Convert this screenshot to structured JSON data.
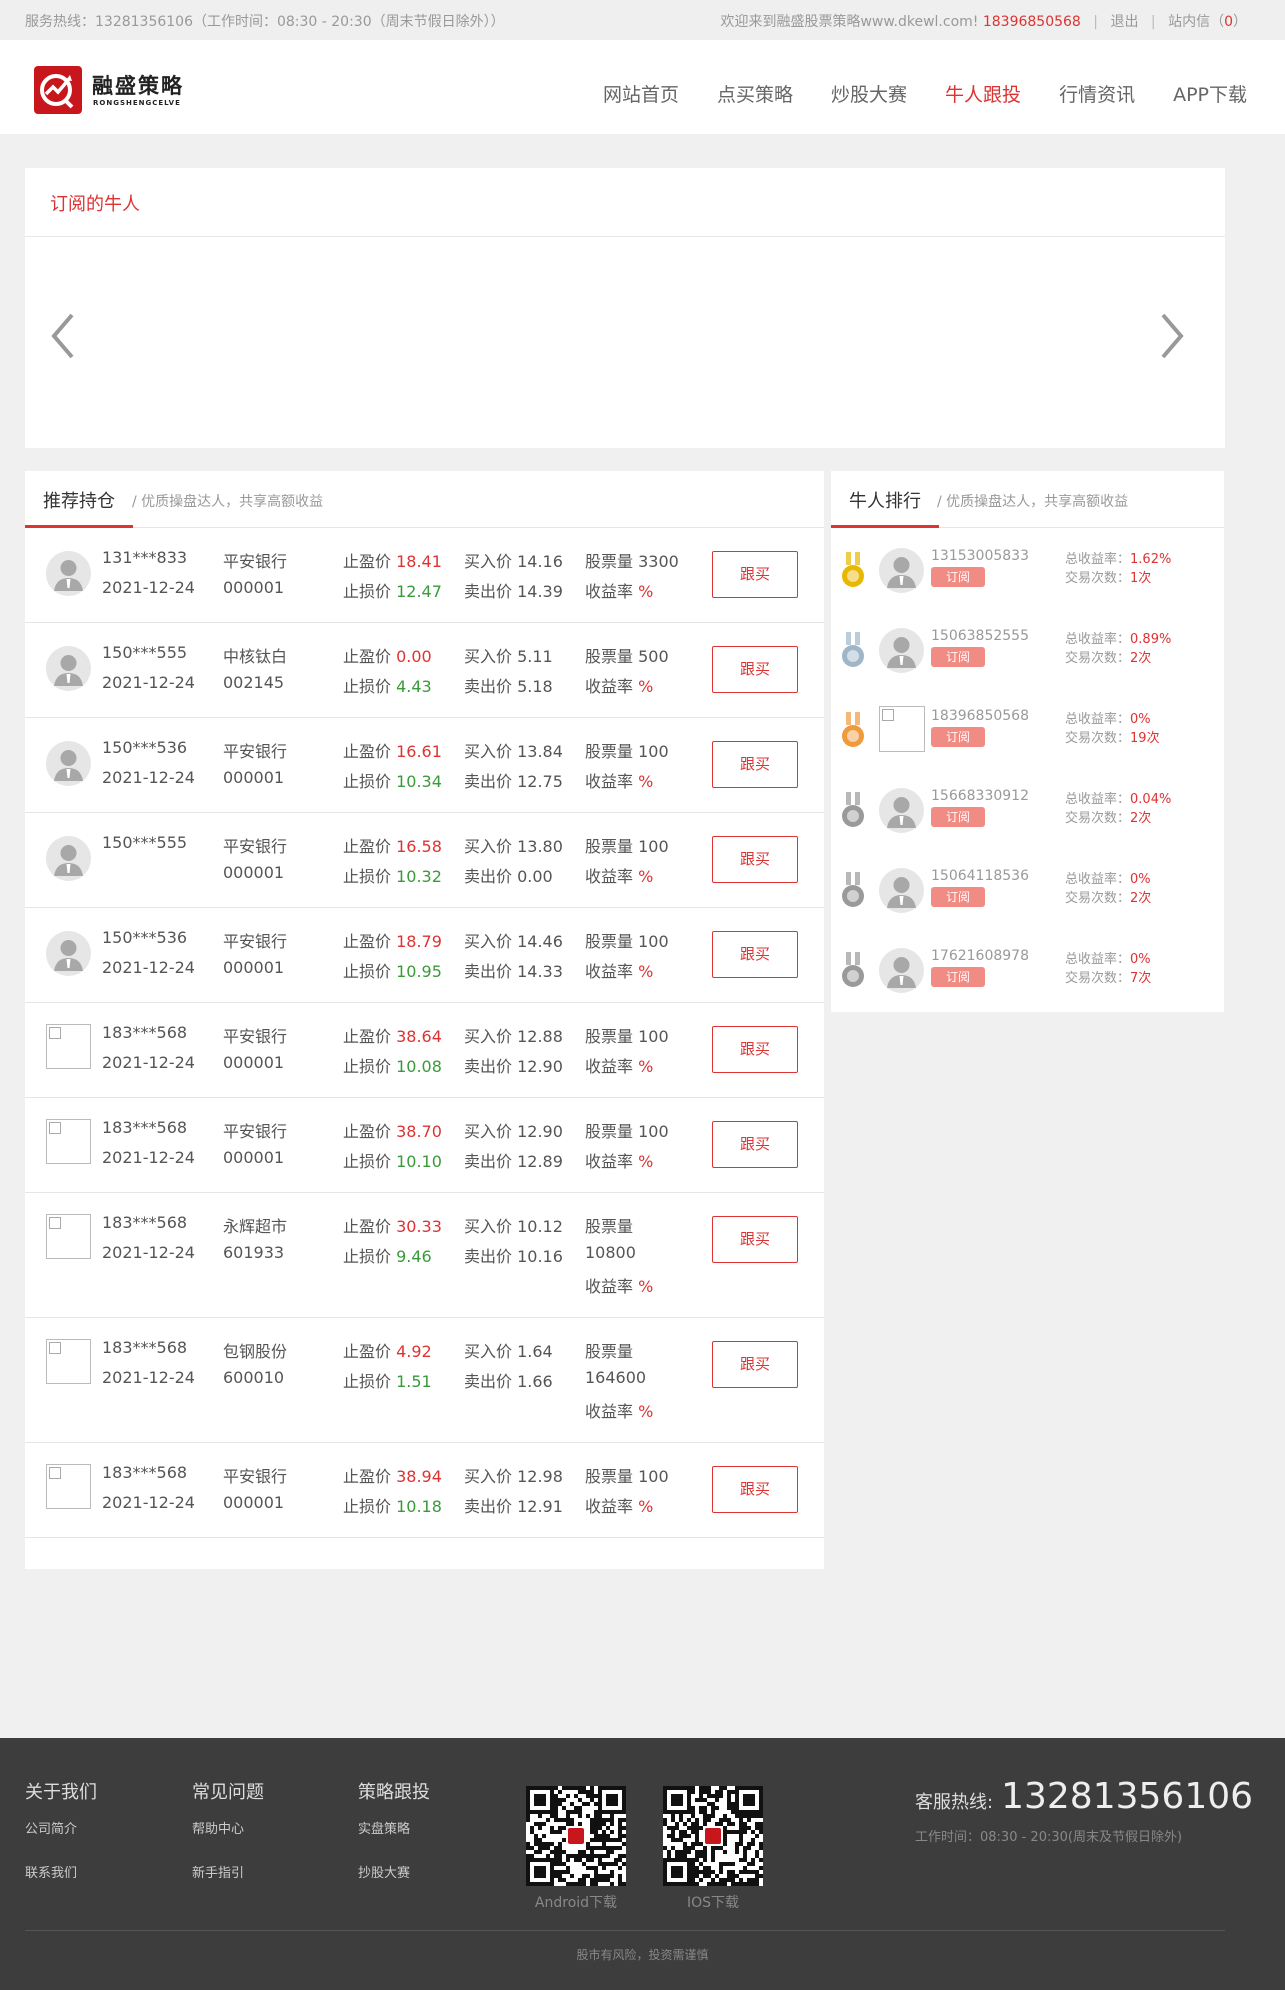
{
  "topbar": {
    "hotline": "服务热线：13281356106（工作时间：08:30 - 20:30（周末节假日除外））",
    "welcome": "欢迎来到融盛股票策略www.dkewl.com!",
    "user_phone": "18396850568",
    "logout": "退出",
    "messages_label": "站内信（",
    "messages_count": "0",
    "messages_close": "）"
  },
  "header": {
    "logo_cn": "融盛策略",
    "logo_en": "RONGSHENGCELVE",
    "nav": [
      "网站首页",
      "点买策略",
      "炒股大赛",
      "牛人跟投",
      "行情资讯",
      "APP下载"
    ],
    "nav_active": 3
  },
  "subscribed": {
    "title": "订阅的牛人"
  },
  "holdings": {
    "title": "推荐持仓",
    "subtitle": "/ 优质操盘达人，共享高额收益",
    "labels": {
      "take_profit": "止盈价",
      "stop_loss": "止损价",
      "buy_price": "买入价",
      "sell_price": "卖出价",
      "shares": "股票量",
      "yield": "收益率",
      "percent": "%",
      "follow": "跟买"
    },
    "rows": [
      {
        "user": "131***833",
        "date": "2021-12-24",
        "stock": "平安银行",
        "code": "000001",
        "tp": "18.41",
        "sl": "12.47",
        "buy": "14.16",
        "sell": "14.39",
        "shares": "3300",
        "avatar": "default"
      },
      {
        "user": "150***555",
        "date": "2021-12-24",
        "stock": "中核钛白",
        "code": "002145",
        "tp": "0.00",
        "sl": "4.43",
        "buy": "5.11",
        "sell": "5.18",
        "shares": "500",
        "avatar": "default"
      },
      {
        "user": "150***536",
        "date": "2021-12-24",
        "stock": "平安银行",
        "code": "000001",
        "tp": "16.61",
        "sl": "10.34",
        "buy": "13.84",
        "sell": "12.75",
        "shares": "100",
        "avatar": "default"
      },
      {
        "user": "150***555",
        "date": "",
        "stock": "平安银行",
        "code": "000001",
        "tp": "16.58",
        "sl": "10.32",
        "buy": "13.80",
        "sell": "0.00",
        "shares": "100",
        "avatar": "default"
      },
      {
        "user": "150***536",
        "date": "2021-12-24",
        "stock": "平安银行",
        "code": "000001",
        "tp": "18.79",
        "sl": "10.95",
        "buy": "14.46",
        "sell": "14.33",
        "shares": "100",
        "avatar": "default"
      },
      {
        "user": "183***568",
        "date": "2021-12-24",
        "stock": "平安银行",
        "code": "000001",
        "tp": "38.64",
        "sl": "10.08",
        "buy": "12.88",
        "sell": "12.90",
        "shares": "100",
        "avatar": "broken"
      },
      {
        "user": "183***568",
        "date": "2021-12-24",
        "stock": "平安银行",
        "code": "000001",
        "tp": "38.70",
        "sl": "10.10",
        "buy": "12.90",
        "sell": "12.89",
        "shares": "100",
        "avatar": "broken"
      },
      {
        "user": "183***568",
        "date": "2021-12-24",
        "stock": "永辉超市",
        "code": "601933",
        "tp": "30.33",
        "sl": "9.46",
        "buy": "10.12",
        "sell": "10.16",
        "shares": "10800",
        "avatar": "broken",
        "wrap": true
      },
      {
        "user": "183***568",
        "date": "2021-12-24",
        "stock": "包钢股份",
        "code": "600010",
        "tp": "4.92",
        "sl": "1.51",
        "buy": "1.64",
        "sell": "1.66",
        "shares": "164600",
        "avatar": "broken",
        "wrap": true
      },
      {
        "user": "183***568",
        "date": "2021-12-24",
        "stock": "平安银行",
        "code": "000001",
        "tp": "38.94",
        "sl": "10.18",
        "buy": "12.98",
        "sell": "12.91",
        "shares": "100",
        "avatar": "broken"
      }
    ]
  },
  "ranking": {
    "title": "牛人排行",
    "subtitle": "/ 优质操盘达人，共享高额收益",
    "labels": {
      "total_yield": "总收益率：",
      "trades": "交易次数：",
      "subscribe": "订阅",
      "times": "次"
    },
    "items": [
      {
        "phone": "13153005833",
        "yield": "1.62%",
        "trades": "1",
        "medal": "gold",
        "medal_color": "#e8b800",
        "avatar": "default"
      },
      {
        "phone": "15063852555",
        "yield": "0.89%",
        "trades": "2",
        "medal": "silver",
        "medal_color": "#9fb6c9",
        "avatar": "default"
      },
      {
        "phone": "18396850568",
        "yield": "0%",
        "trades": "19",
        "medal": "bronze",
        "medal_color": "#f09a3e",
        "avatar": "broken"
      },
      {
        "phone": "15668330912",
        "yield": "0.04%",
        "trades": "2",
        "medal": "gray",
        "medal_color": "#9a9a9a",
        "avatar": "default"
      },
      {
        "phone": "15064118536",
        "yield": "0%",
        "trades": "2",
        "medal": "gray",
        "medal_color": "#9a9a9a",
        "avatar": "default"
      },
      {
        "phone": "17621608978",
        "yield": "0%",
        "trades": "7",
        "medal": "gray",
        "medal_color": "#9a9a9a",
        "avatar": "default"
      }
    ]
  },
  "footer": {
    "cols": [
      {
        "title": "关于我们",
        "links": [
          "公司简介",
          "联系我们"
        ]
      },
      {
        "title": "常见问题",
        "links": [
          "帮助中心",
          "新手指引"
        ]
      },
      {
        "title": "策略跟投",
        "links": [
          "实盘策略",
          "抄股大赛"
        ]
      }
    ],
    "qr_android": "Android下载",
    "qr_ios": "IOS下载",
    "hotline_label": "客服热线:",
    "hotline": "13281356106",
    "work_time": "工作时间：08:30 - 20:30(周末及节假日除外)",
    "note": "股市有风险，投资需谨慎"
  },
  "colors": {
    "accent": "#d33333",
    "green": "#3a9a3a",
    "tag": "#f08c84",
    "footer_bg": "#3d3d3d"
  }
}
